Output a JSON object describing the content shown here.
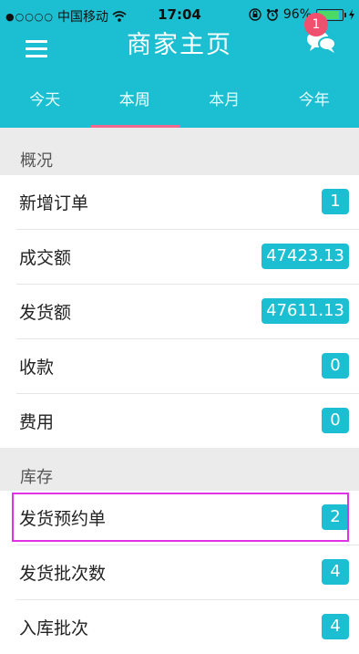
{
  "statusbar": {
    "carrier": "中国移动",
    "signal_dots": "●○○○○",
    "wifi_icon": "wifi-icon",
    "time": "17:04",
    "battery": "96%",
    "battery_icon": "battery-icon"
  },
  "header": {
    "title": "商家主页",
    "message_badge": "1",
    "menu_icon": "menu-icon",
    "chat_icon": "chat-icon"
  },
  "tabs": [
    {
      "label": "今天"
    },
    {
      "label": "本周"
    },
    {
      "label": "本月"
    },
    {
      "label": "今年"
    }
  ],
  "overview": {
    "label": "概况",
    "rows": [
      {
        "label": "新增订单",
        "value": "1"
      },
      {
        "label": "成交额",
        "value": "47423.13"
      },
      {
        "label": "发货额",
        "value": "47611.13"
      },
      {
        "label": "收款",
        "value": "0"
      },
      {
        "label": "费用",
        "value": "0"
      }
    ]
  },
  "inventory": {
    "label": "库存",
    "rows": [
      {
        "label": "发货预约单",
        "value": "2"
      },
      {
        "label": "发货批次数",
        "value": "4"
      },
      {
        "label": "入库批次",
        "value": "4"
      }
    ]
  },
  "colors": {
    "accent": "#1cbfd1",
    "tab_indicator": "#f06a8d",
    "badge": "#f0506e",
    "highlight": "#e033e7"
  }
}
